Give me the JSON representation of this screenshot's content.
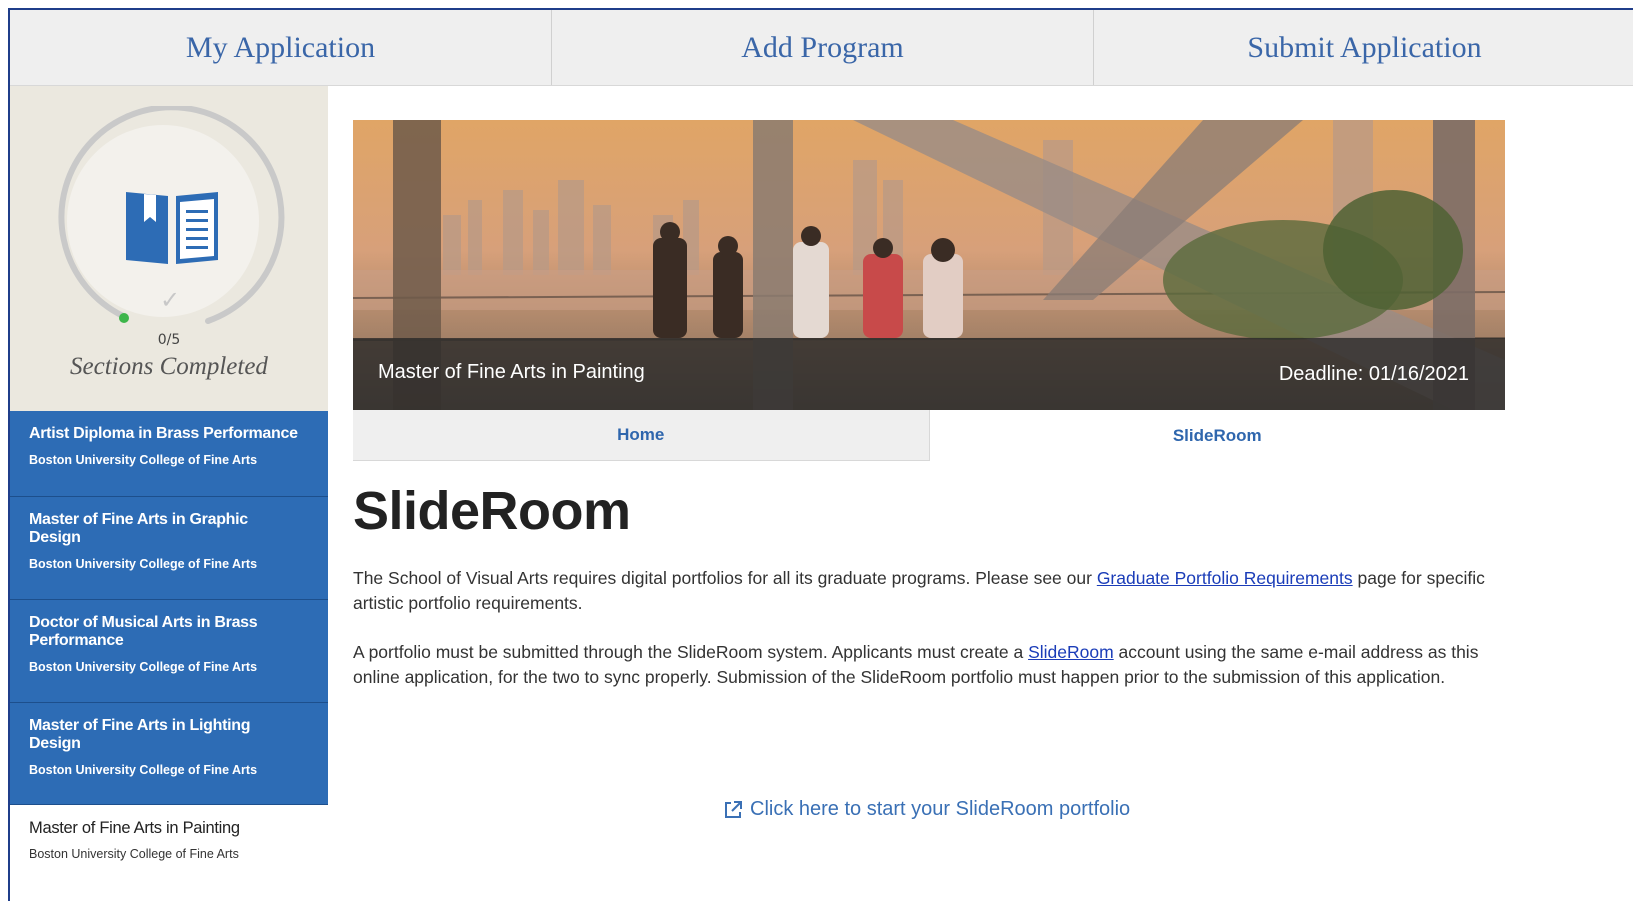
{
  "topnav": {
    "tabs": [
      {
        "label": "My Application"
      },
      {
        "label": "Add Program"
      },
      {
        "label": "Submit Application"
      }
    ]
  },
  "sidebar": {
    "progress": {
      "count": "0/5",
      "label": "Sections Completed",
      "completed_fraction": 0
    },
    "programs": [
      {
        "name": "Artist Diploma in Brass Performance",
        "school": "Boston University College of Fine Arts"
      },
      {
        "name": "Master of Fine Arts in Graphic Design",
        "school": "Boston University College of Fine Arts"
      },
      {
        "name": "Doctor of Musical Arts in Brass Performance",
        "school": "Boston University College of Fine Arts"
      },
      {
        "name": "Master of Fine Arts in Lighting Design",
        "school": "Boston University College of Fine Arts"
      },
      {
        "name": "Master of Fine Arts in Painting",
        "school": "Boston University College of Fine Arts",
        "active": true
      }
    ]
  },
  "hero": {
    "program": "Master of Fine Arts in Painting",
    "deadline": "Deadline: 01/16/2021"
  },
  "subtabs": {
    "home": "Home",
    "slideroom": "SlideRoom"
  },
  "content": {
    "title": "SlideRoom",
    "p1_before": "The School of Visual Arts requires digital portfolios for all its graduate programs. Please see our ",
    "p1_link": "Graduate Portfolio Requirements",
    "p1_after": " page for specific artistic portfolio requirements.",
    "p2_before": "A portfolio must be submitted through the SlideRoom system. Applicants must create a ",
    "p2_link": "SlideRoom",
    "p2_after": " account using the same e-mail address as this online application, for the two to sync properly. Submission of the SlideRoom portfolio must happen prior to the submission of this application.",
    "start_link": "Click here to start your SlideRoom portfolio",
    "start_icon": "external-link-icon"
  },
  "colors": {
    "accent": "#2d6cb5",
    "nav_text": "#3a66a8",
    "link": "#1a3cb8"
  }
}
